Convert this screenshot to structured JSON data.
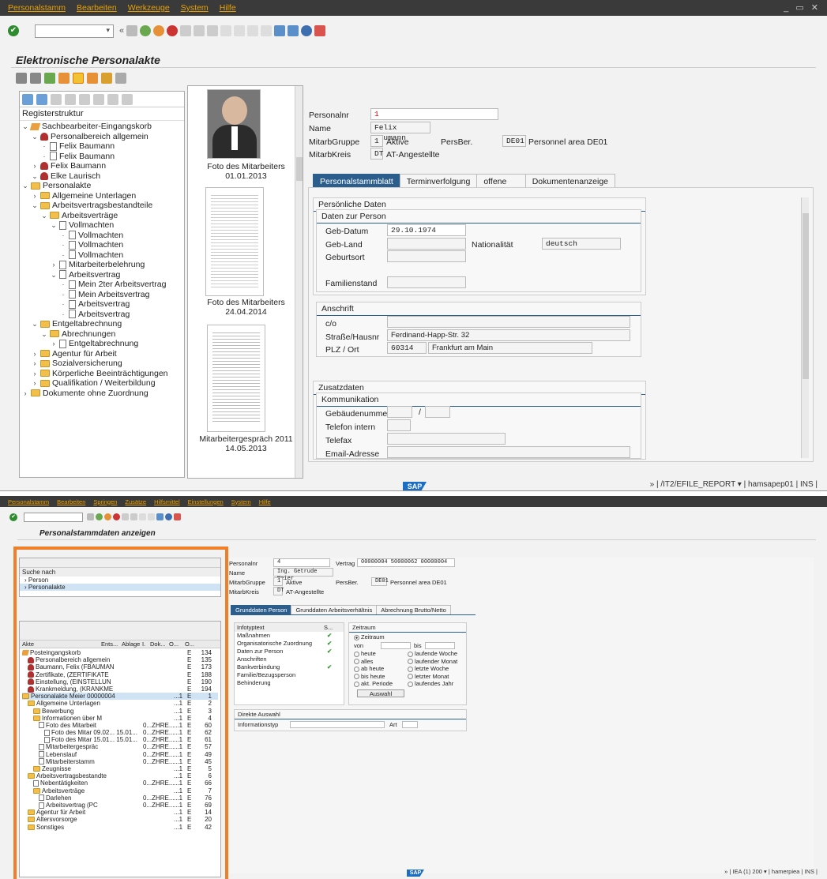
{
  "window1": {
    "menu": [
      "Personalstamm",
      "Bearbeiten",
      "Werkzeuge",
      "System",
      "Hilfe"
    ],
    "window_controls": "_ ▭ ✕",
    "title": "Elektronische Personalakte",
    "tree_header": "Registerstruktur",
    "tree": [
      {
        "level": 0,
        "caret": "v",
        "icon": "cat",
        "label": "Sachbearbeiter-Eingangskorb"
      },
      {
        "level": 1,
        "caret": "v",
        "icon": "person",
        "label": "Personalbereich allgemein"
      },
      {
        "level": 2,
        "caret": "·",
        "icon": "doc",
        "label": "Felix Baumann"
      },
      {
        "level": 2,
        "caret": "·",
        "icon": "doc",
        "label": "Felix Baumann"
      },
      {
        "level": 1,
        "caret": ">",
        "icon": "person",
        "label": "Felix Baumann"
      },
      {
        "level": 1,
        "caret": "v",
        "icon": "person",
        "label": "Elke Laurisch"
      },
      {
        "level": 0,
        "caret": "v",
        "icon": "fold",
        "label": "Personalakte"
      },
      {
        "level": 1,
        "caret": ">",
        "icon": "fold",
        "label": "Allgemeine Unterlagen"
      },
      {
        "level": 1,
        "caret": "v",
        "icon": "fold",
        "label": "Arbeitsvertragsbestandteile"
      },
      {
        "level": 2,
        "caret": "v",
        "icon": "fold",
        "label": "Arbeitsverträge"
      },
      {
        "level": 3,
        "caret": "v",
        "icon": "doc",
        "label": "Vollmachten"
      },
      {
        "level": 4,
        "caret": "·",
        "icon": "doc",
        "label": "Vollmachten"
      },
      {
        "level": 4,
        "caret": "·",
        "icon": "doc",
        "label": "Vollmachten"
      },
      {
        "level": 4,
        "caret": "·",
        "icon": "doc",
        "label": "Vollmachten"
      },
      {
        "level": 3,
        "caret": ">",
        "icon": "doc",
        "label": "Mitarbeiterbelehrung"
      },
      {
        "level": 3,
        "caret": "v",
        "icon": "doc",
        "label": "Arbeitsvertrag"
      },
      {
        "level": 4,
        "caret": "·",
        "icon": "doc",
        "label": "Mein 2ter Arbeitsvertrag"
      },
      {
        "level": 4,
        "caret": "·",
        "icon": "doc",
        "label": "Mein Arbeitsvertrag"
      },
      {
        "level": 4,
        "caret": "·",
        "icon": "doc",
        "label": "Arbeitsvertrag"
      },
      {
        "level": 4,
        "caret": "·",
        "icon": "doc",
        "label": "Arbeitsvertrag"
      },
      {
        "level": 1,
        "caret": "v",
        "icon": "fold",
        "label": "Entgeltabrechnung"
      },
      {
        "level": 2,
        "caret": "v",
        "icon": "fold",
        "label": "Abrechnungen"
      },
      {
        "level": 3,
        "caret": ">",
        "icon": "doc",
        "label": "Entgeltabrechnung"
      },
      {
        "level": 1,
        "caret": ">",
        "icon": "fold",
        "label": "Agentur für Arbeit"
      },
      {
        "level": 1,
        "caret": ">",
        "icon": "fold",
        "label": "Sozialversicherung"
      },
      {
        "level": 1,
        "caret": ">",
        "icon": "fold",
        "label": "Körperliche Beeinträchtigungen"
      },
      {
        "level": 1,
        "caret": ">",
        "icon": "fold",
        "label": "Qualifikation / Weiterbildung"
      },
      {
        "level": 0,
        "caret": ">",
        "icon": "fold",
        "label": "Dokumente ohne Zuordnung"
      }
    ],
    "thumbs": [
      {
        "caption1": "Foto des Mitarbeiters",
        "caption2": "01.01.2013"
      },
      {
        "caption1": "Foto des Mitarbeiters",
        "caption2": "24.04.2014"
      },
      {
        "caption1": "Mitarbeitergespräch 2011",
        "caption2": "14.05.2013"
      }
    ],
    "header": {
      "personalnr_label": "Personalnr",
      "personalnr": "1",
      "name_label": "Name",
      "name": "Felix Baumann",
      "mitarbgruppe_label": "MitarbGruppe",
      "mitarbgruppe_code": "1",
      "mitarbgruppe_text": "Aktive",
      "persber_label": "PersBer.",
      "persber_code": "DE01",
      "persber_text": "Personnel area DE01",
      "mitarbkreis_label": "MitarbKreis",
      "mitarbkreis_code": "DT",
      "mitarbkreis_text": "AT-Angestellte"
    },
    "tabs": [
      "Personalstammblatt",
      "Terminverfolgung",
      "offene Barcodes",
      "Dokumentenanzeige"
    ],
    "persoenliche": {
      "title": "Persönliche Daten",
      "sub": "Daten zur Person",
      "gebdatum_label": "Geb-Datum",
      "gebdatum": "29.10.1974",
      "gebland_label": "Geb-Land",
      "gebland": "",
      "nationalitaet_label": "Nationalität",
      "nationalitaet": "deutsch",
      "geburtsort_label": "Geburtsort",
      "familienstand_label": "Familienstand"
    },
    "anschrift": {
      "title": "Anschrift",
      "co_label": "c/o",
      "strasse_label": "Straße/Hausnr",
      "strasse": "Ferdinand-Happ-Str. 32",
      "plz_label": "PLZ / Ort",
      "plz": "60314",
      "ort": "Frankfurt am Main"
    },
    "zusatz": {
      "title": "Zusatzdaten",
      "sub": "Kommunikation",
      "gebaeude_label": "Gebäudenummer",
      "telefon_label": "Telefon intern",
      "telefax_label": "Telefax",
      "email_label": "Email-Adresse"
    },
    "status": "» | /IT2/EFILE_REPORT ▾ | hamsapep01 | INS |"
  },
  "window2": {
    "menu": [
      "Personalstamm",
      "Bearbeiten",
      "Springen",
      "Zusätze",
      "Hilfsmittel",
      "Einstellungen",
      "System",
      "Hilfe"
    ],
    "title": "Personalstammdaten anzeigen",
    "search_label": "Suche nach",
    "search_items": [
      "Person",
      "Personalakte"
    ],
    "tree_cols": [
      "Akte",
      "Ents...",
      "Ablage",
      "I.",
      "Dok...",
      "O...",
      "O...",
      ""
    ],
    "tree": [
      {
        "level": 0,
        "icon": "cat",
        "label": "Posteingangskorb",
        "c1": "",
        "c2": "",
        "c3": "E",
        "c4": "134"
      },
      {
        "level": 1,
        "icon": "person",
        "label": "Personalbereich allgemein",
        "c1": "",
        "c2": "",
        "c3": "E",
        "c4": "135"
      },
      {
        "level": 1,
        "icon": "person",
        "label": "Baumann, Felix (FBAUMAN",
        "c1": "",
        "c2": "",
        "c3": "E",
        "c4": "173"
      },
      {
        "level": 1,
        "icon": "person",
        "label": "Zertifikate, (ZERTIFIKATE",
        "c1": "",
        "c2": "",
        "c3": "E",
        "c4": "188"
      },
      {
        "level": 1,
        "icon": "person",
        "label": "Einstellung, (EINSTELLUN",
        "c1": "",
        "c2": "",
        "c3": "E",
        "c4": "190"
      },
      {
        "level": 1,
        "icon": "person",
        "label": "Krankmeldung, (KRANKME",
        "c1": "",
        "c2": "",
        "c3": "E",
        "c4": "194"
      },
      {
        "level": 0,
        "icon": "fold",
        "label": "Personalakte Meier 00000004",
        "c1": "",
        "c2": "...1",
        "c3": "E",
        "c4": "1"
      },
      {
        "level": 1,
        "icon": "fold",
        "label": "Allgemeine Unterlagen",
        "c1": "",
        "c2": "...1",
        "c3": "E",
        "c4": "2"
      },
      {
        "level": 2,
        "icon": "fold",
        "label": "Bewerbung",
        "c1": "",
        "c2": "...1",
        "c3": "E",
        "c4": "3"
      },
      {
        "level": 2,
        "icon": "fold",
        "label": "Informationen über M",
        "c1": "",
        "c2": "...1",
        "c3": "E",
        "c4": "4"
      },
      {
        "level": 3,
        "icon": "doc",
        "label": "Foto des Mitarbeit",
        "c1": "0...ZHRE...",
        "c2": "...1",
        "c3": "E",
        "c4": "60"
      },
      {
        "level": 4,
        "icon": "doc",
        "label": "Foto des Mitar 09.02... 15.01...",
        "c1": "0...ZHRE...",
        "c2": "...1",
        "c3": "E",
        "c4": "62"
      },
      {
        "level": 4,
        "icon": "doc",
        "label": "Foto des Mitar 15.01... 15.01...",
        "c1": "0...ZHRE...",
        "c2": "...1",
        "c3": "E",
        "c4": "61"
      },
      {
        "level": 3,
        "icon": "doc",
        "label": "Mitarbeitergespräc",
        "c1": "0...ZHRE...",
        "c2": "...1",
        "c3": "E",
        "c4": "57"
      },
      {
        "level": 3,
        "icon": "doc",
        "label": "Lebenslauf",
        "c1": "0...ZHRE...",
        "c2": "...1",
        "c3": "E",
        "c4": "49"
      },
      {
        "level": 3,
        "icon": "doc",
        "label": "Mitarbeiterstamm",
        "c1": "0...ZHRE...",
        "c2": "...1",
        "c3": "E",
        "c4": "45"
      },
      {
        "level": 2,
        "icon": "fold",
        "label": "Zeugnisse",
        "c1": "",
        "c2": "...1",
        "c3": "E",
        "c4": "5"
      },
      {
        "level": 1,
        "icon": "fold",
        "label": "Arbeitsvertragsbestandte",
        "c1": "",
        "c2": "...1",
        "c3": "E",
        "c4": "6"
      },
      {
        "level": 2,
        "icon": "doc",
        "label": "Nebentätigkeiten",
        "c1": "0...ZHRE...",
        "c2": "...1",
        "c3": "E",
        "c4": "66"
      },
      {
        "level": 2,
        "icon": "fold",
        "label": "Arbeitsverträge",
        "c1": "",
        "c2": "...1",
        "c3": "E",
        "c4": "7"
      },
      {
        "level": 3,
        "icon": "doc",
        "label": "Darlehen",
        "c1": "0...ZHRE...",
        "c2": "...1",
        "c3": "E",
        "c4": "76"
      },
      {
        "level": 3,
        "icon": "doc",
        "label": "Arbeitsvertrag (PC",
        "c1": "0...ZHRE...",
        "c2": "...1",
        "c3": "E",
        "c4": "69"
      },
      {
        "level": 1,
        "icon": "fold",
        "label": "Agentur für Arbeit",
        "c1": "",
        "c2": "...1",
        "c3": "E",
        "c4": "14"
      },
      {
        "level": 1,
        "icon": "fold",
        "label": "Altersvorsorge",
        "c1": "",
        "c2": "...1",
        "c3": "E",
        "c4": "20"
      },
      {
        "level": 1,
        "icon": "fold",
        "label": "Sonstiges",
        "c1": "",
        "c2": "...1",
        "c3": "E",
        "c4": "42"
      }
    ],
    "header": {
      "personalnr_label": "Personalnr",
      "personalnr": "4",
      "vertrag_label": "Vertrag",
      "vertrag": "00000004 50000062 00000004",
      "name_label": "Name",
      "name": "Ing. Getrude Meier",
      "mitarbgruppe_label": "MitarbGruppe",
      "mitarbgruppe_code": "1",
      "mitarbgruppe_text": "Aktive",
      "persber_label": "PersBer.",
      "persber_code": "DE01",
      "persber_text": "Personnel area DE01",
      "mitarbkreis_label": "MitarbKreis",
      "mitarbkreis_code": "DT",
      "mitarbkreis_text": "AT-Angestellte"
    },
    "tabs": [
      "Grunddaten Person",
      "Grunddaten Arbeitsverhältnis",
      "Abrechnung Brutto/Netto"
    ],
    "infotyp_header": "Infotyptext",
    "infotyp_s": "S...",
    "infotypes": [
      {
        "name": "Maßnahmen",
        "check": "✔"
      },
      {
        "name": "Organisatorische Zuordnung",
        "check": "✔"
      },
      {
        "name": "Daten zur Person",
        "check": "✔"
      },
      {
        "name": "Anschriften",
        "check": ""
      },
      {
        "name": "Bankverbindung",
        "check": "✔"
      },
      {
        "name": "Familie/Bezugsperson",
        "check": ""
      },
      {
        "name": "Behinderung",
        "check": ""
      }
    ],
    "zeitraum": {
      "title": "Zeitraum",
      "sel": "Zeitraum",
      "von": "von",
      "bis": "bis",
      "options": [
        [
          "heute",
          "laufende Woche"
        ],
        [
          "alles",
          "laufender Monat"
        ],
        [
          "ab heute",
          "letzte Woche"
        ],
        [
          "bis heute",
          "letzter Monat"
        ],
        [
          "akt. Periode",
          "laufendes Jahr"
        ]
      ],
      "button": "Auswahl"
    },
    "direkt": {
      "title": "Direkte Auswahl",
      "info_label": "Informationstyp",
      "art_label": "Art"
    },
    "status": "» | IEA (1) 200 ▾ | hamerpiea | INS |"
  }
}
